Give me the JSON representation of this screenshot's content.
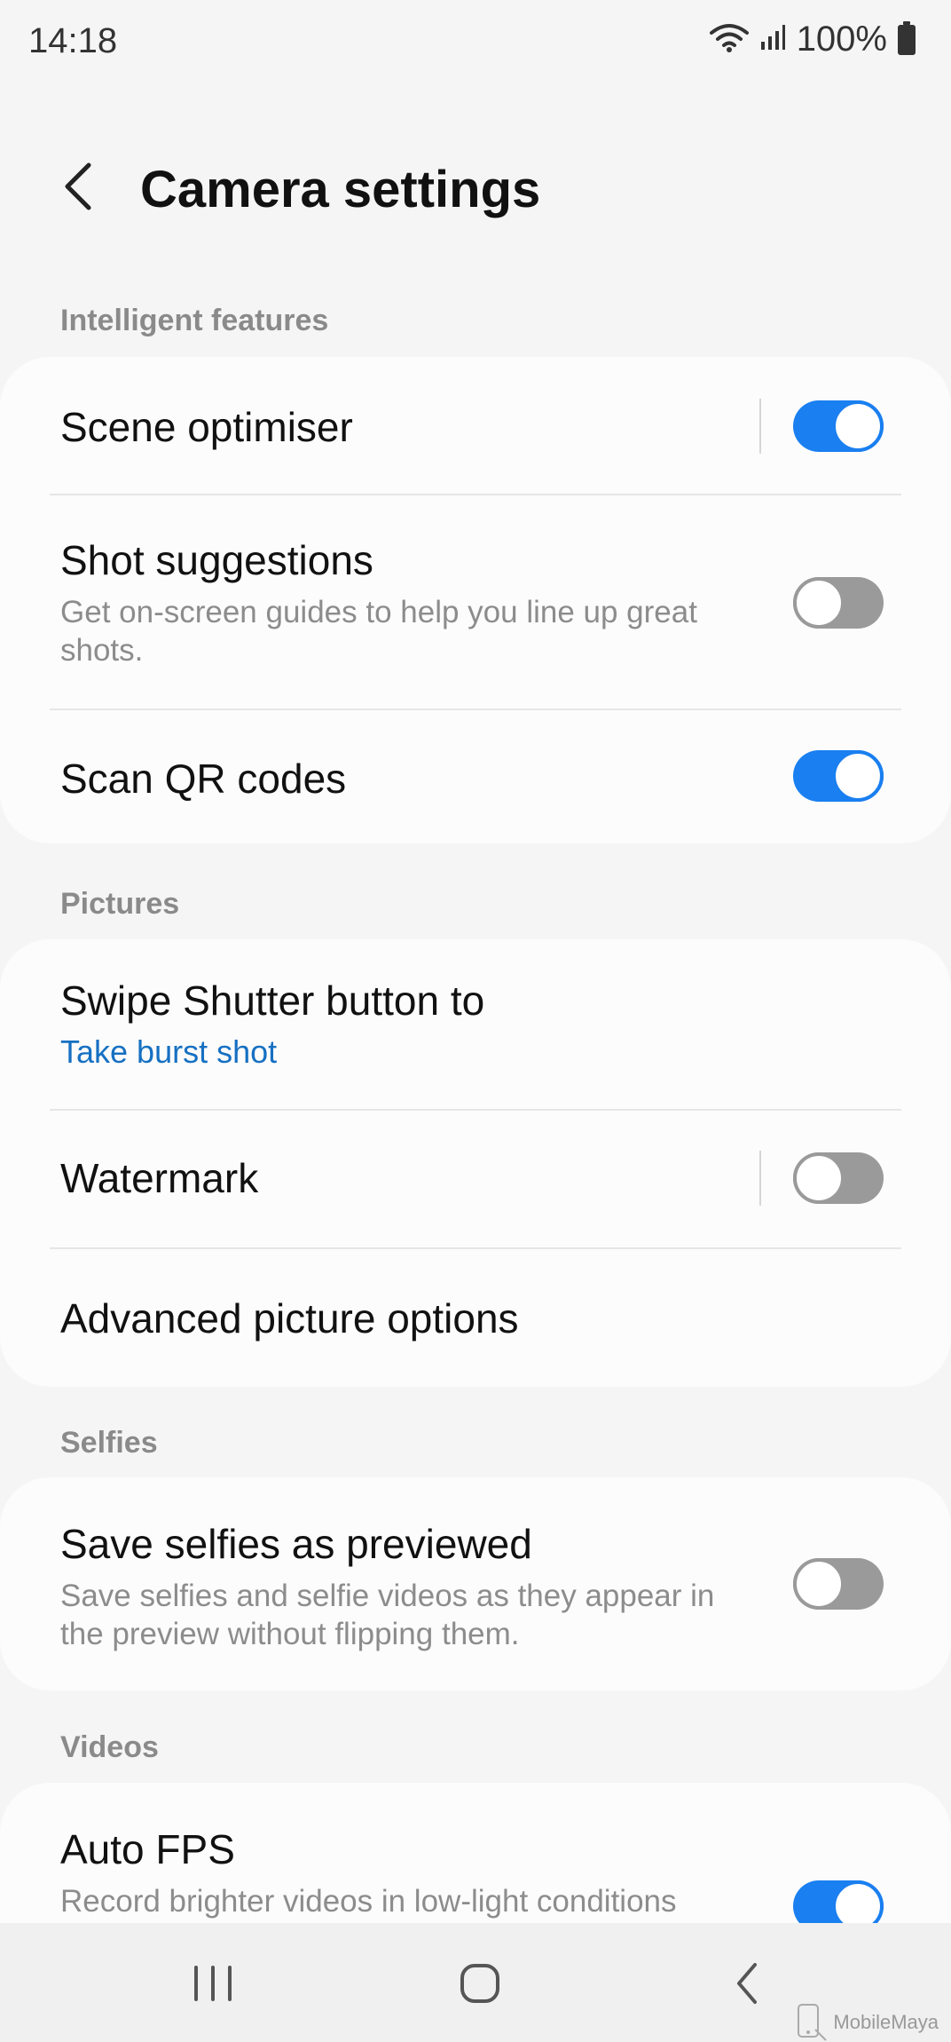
{
  "status_bar": {
    "time": "14:18",
    "battery": "100%"
  },
  "header": {
    "title": "Camera settings"
  },
  "sections": {
    "intelligent": {
      "label": "Intelligent features",
      "items": [
        {
          "title": "Scene optimiser",
          "toggle": "on"
        },
        {
          "title": "Shot suggestions",
          "description": "Get on-screen guides to help you line up great shots.",
          "toggle": "off"
        },
        {
          "title": "Scan QR codes",
          "toggle": "on"
        }
      ]
    },
    "pictures": {
      "label": "Pictures",
      "items": [
        {
          "title": "Swipe Shutter button to",
          "value": "Take burst shot"
        },
        {
          "title": "Watermark",
          "toggle": "off"
        },
        {
          "title": "Advanced picture options"
        }
      ]
    },
    "selfies": {
      "label": "Selfies",
      "items": [
        {
          "title": "Save selfies as previewed",
          "description": "Save selfies and selfie videos as they appear in the preview without flipping them.",
          "toggle": "off"
        }
      ]
    },
    "videos": {
      "label": "Videos",
      "items": [
        {
          "title": "Auto FPS",
          "description": "Record brighter videos in low-light conditions",
          "toggle": "on"
        }
      ]
    }
  },
  "nav_bar": {
    "buttons": [
      "recent-apps",
      "home",
      "back"
    ]
  },
  "watermark_logo": "MobileMaya",
  "colors": {
    "accent": "#1a7ff0",
    "link": "#1670c2",
    "toggle_off": "#9a9a9a",
    "background": "#f5f5f5",
    "card": "#fcfcfc"
  }
}
